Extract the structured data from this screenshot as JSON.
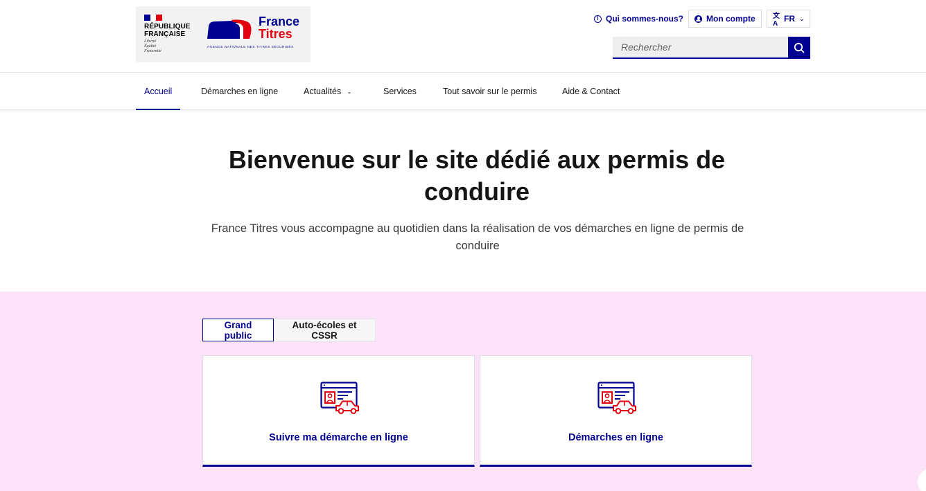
{
  "header": {
    "gov_brand": {
      "line1": "RÉPUBLIQUE",
      "line2": "FRANÇAISE",
      "motto1": "Liberté",
      "motto2": "Égalité",
      "motto3": "Fraternité"
    },
    "site_brand": {
      "line1": "France",
      "line2": "Titres",
      "tagline": "AGENCE NATIONALE DES TITRES SÉCURISÉS"
    },
    "tools": {
      "about": "Qui sommes-nous?",
      "account": "Mon compte",
      "language": "FR"
    },
    "search": {
      "placeholder": "Rechercher"
    }
  },
  "nav": {
    "items": [
      {
        "label": "Accueil"
      },
      {
        "label": "Démarches en ligne"
      },
      {
        "label": "Actualités"
      },
      {
        "label": "Services"
      },
      {
        "label": "Tout savoir sur le permis"
      },
      {
        "label": "Aide & Contact"
      }
    ],
    "active": "Accueil"
  },
  "hero": {
    "title": "Bienvenue sur le site dédié aux permis de conduire",
    "subtitle": "France Titres vous accompagne au quotidien dans la réalisation de vos démarches en ligne de permis de conduire"
  },
  "audience_tabs": {
    "items": [
      {
        "label": "Grand public"
      },
      {
        "label": "Auto-écoles et CSSR"
      }
    ],
    "selected": "Grand public"
  },
  "cards": [
    {
      "label": "Suivre ma démarche en ligne",
      "icon": "license-car-icon"
    },
    {
      "label": "Démarches en ligne",
      "icon": "license-car-icon"
    }
  ],
  "colors": {
    "primary_blue": "#000091",
    "accent_red": "#e1000f",
    "pink_background": "#fce3f9",
    "text": "#161616"
  }
}
